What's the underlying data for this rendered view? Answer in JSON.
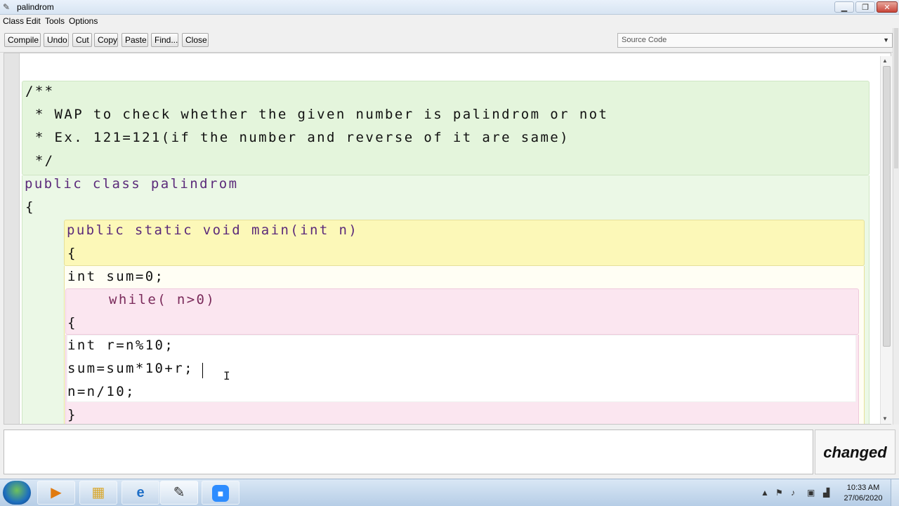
{
  "window": {
    "title": "palindrom"
  },
  "menu": [
    "Class",
    "Edit",
    "Tools",
    "Options"
  ],
  "toolbar": {
    "buttons": [
      "Compile",
      "Undo",
      "Cut",
      "Copy",
      "Paste",
      "Find...",
      "Close"
    ]
  },
  "view_select": {
    "value": "Source Code"
  },
  "code": {
    "lines": [
      "/**",
      " * WAP to check whether the given number is palindrom or not",
      " * Ex. 121=121(if the number and reverse of it are same)",
      " */",
      "public class palindrom",
      "{",
      "public static void main(int n)",
      "{",
      "int sum=0;",
      "while( n>0)",
      "{",
      "int r=n%10;",
      "sum=sum*10+r;",
      "n=n/10;",
      "}"
    ]
  },
  "status": {
    "message": "",
    "changed_label": "changed"
  },
  "taskbar": {
    "apps": [
      "start-orb",
      "media-player",
      "file-explorer",
      "internet-explorer",
      "bluej",
      "zoom"
    ],
    "clock": {
      "time": "10:33 AM",
      "date": "27/06/2020"
    }
  },
  "colors": {
    "comment_bg": "#e4f5dc",
    "class_bg": "#ebf8e6",
    "method_header_bg": "#fcf8b8",
    "while_bg": "#fbe6f0",
    "keyword": "#5b2a7a"
  }
}
